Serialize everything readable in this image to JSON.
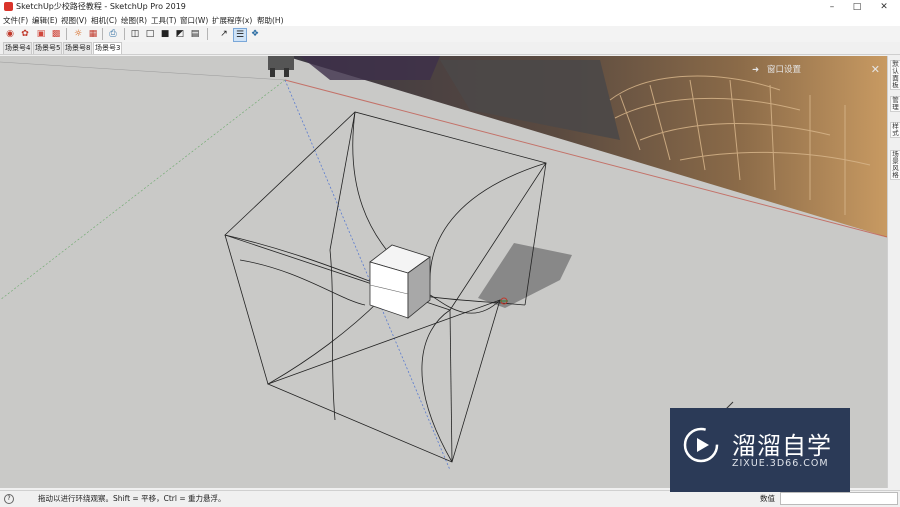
{
  "window": {
    "title": "SketchUp少校路径教程 - SketchUp Pro 2019",
    "minimize_icon": "minimize-icon",
    "maximize_icon": "maximize-icon",
    "close_icon": "close-icon"
  },
  "menu": [
    "文件(F)",
    "编辑(E)",
    "视图(V)",
    "相机(C)",
    "绘图(R)",
    "工具(T)",
    "窗口(W)",
    "扩展程序(x)",
    "帮助(H)"
  ],
  "toolbar": {
    "icons": [
      "sketchup-logo-icon",
      "warehouse-icon",
      "extension-warehouse-icon",
      "layout-icon",
      "style-builder-icon",
      "generate-report-icon",
      "print-icon",
      "section-plane-icon",
      "display-section-planes-icon",
      "display-section-cuts-icon",
      "display-section-fill-icon",
      "axes-icon",
      "outliner-icon",
      "component-icon"
    ]
  },
  "scenes": [
    "场景号4",
    "场景号5",
    "场景号8",
    "场景号3"
  ],
  "active_scene": "场景号3",
  "tray": {
    "title": "窗口设置"
  },
  "side_tabs": [
    "默认面板",
    "管理",
    "样式",
    "场景风格"
  ],
  "status": {
    "message": "拖动以进行环绕观察。Shift = 平移，Ctrl = 重力悬浮。",
    "measurements_label": "数值",
    "measurements_value": ""
  },
  "watermark": {
    "title": "溜溜自学",
    "subtitle": "ZIXUE.3D66.COM"
  },
  "colors": {
    "viewport_ground": "#c9c9c7",
    "watermark_bg": "#2b3a57",
    "accent_red": "#d9342b"
  }
}
